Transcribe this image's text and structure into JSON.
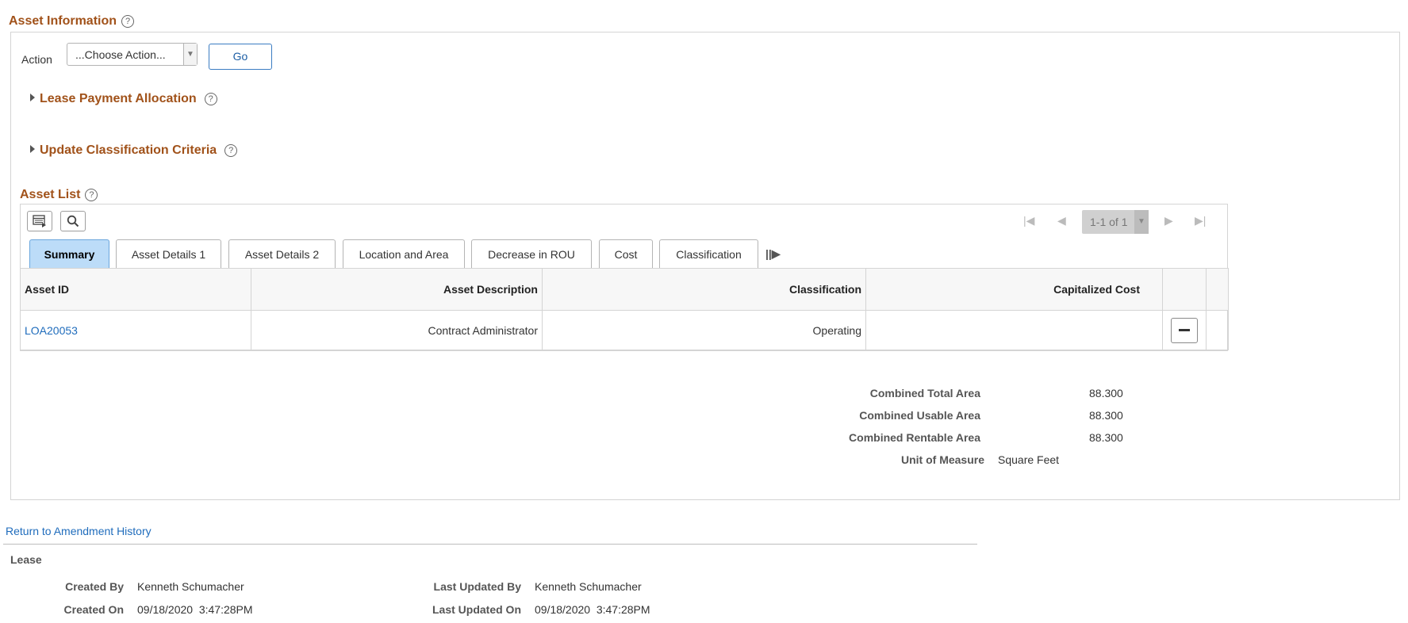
{
  "asset_information": {
    "title": "Asset Information",
    "help": "?"
  },
  "action": {
    "label": "Action",
    "select_value": "...Choose Action...",
    "go_label": "Go"
  },
  "sections": {
    "lease_payment": "Lease Payment Allocation",
    "update_classification": "Update Classification Criteria"
  },
  "asset_list": {
    "title": "Asset List",
    "pager": "1-1 of 1",
    "tabs": [
      {
        "label": "Summary",
        "active": true
      },
      {
        "label": "Asset Details 1"
      },
      {
        "label": "Asset Details 2"
      },
      {
        "label": "Location and Area"
      },
      {
        "label": "Decrease in ROU"
      },
      {
        "label": "Cost"
      },
      {
        "label": "Classification"
      }
    ],
    "columns": [
      "Asset ID",
      "Asset Description",
      "Classification",
      "Capitalized Cost"
    ],
    "rows": [
      {
        "asset_id": "LOA20053",
        "description": "Contract Administrator",
        "classification": "Operating",
        "capitalized_cost": ""
      }
    ]
  },
  "totals": {
    "total_area_label": "Combined Total Area",
    "total_area": "88.300",
    "usable_area_label": "Combined Usable Area",
    "usable_area": "88.300",
    "rentable_area_label": "Combined Rentable Area",
    "rentable_area": "88.300",
    "uom_label": "Unit of Measure",
    "uom": "Square Feet"
  },
  "return_link": "Return to Amendment History",
  "footer": {
    "section": "Lease",
    "created_by_label": "Created By",
    "created_by": "Kenneth Schumacher",
    "created_on_label": "Created On",
    "created_on": "09/18/2020  3:47:28PM",
    "updated_by_label": "Last Updated By",
    "updated_by": "Kenneth Schumacher",
    "updated_on_label": "Last Updated On",
    "updated_on": "09/18/2020  3:47:28PM"
  },
  "icons": {
    "help": "help-circle-icon",
    "personalize": "grid-personalize-icon",
    "search": "search-icon",
    "first": "first-page-icon",
    "prev": "previous-page-icon",
    "next": "next-page-icon",
    "last": "last-page-icon",
    "more_tabs": "show-all-columns-icon",
    "delete_row": "delete-row-icon",
    "expand": "expand-triangle-icon"
  },
  "colors": {
    "section_title": "#a1521a",
    "link": "#1f6cbc",
    "active_tab": "#bcdcf8"
  }
}
